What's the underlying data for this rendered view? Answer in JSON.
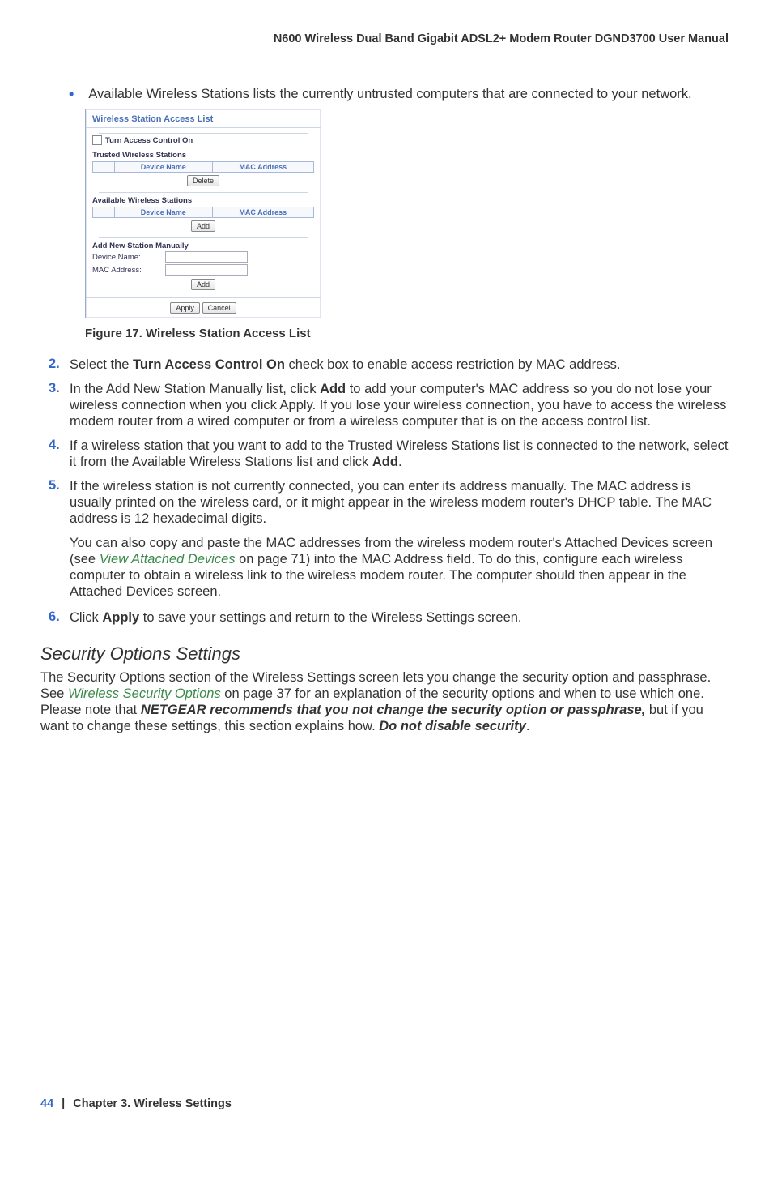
{
  "header": {
    "title": "N600 Wireless Dual Band Gigabit ADSL2+ Modem Router DGND3700 User Manual"
  },
  "bullet": {
    "text": "Available Wireless Stations lists the currently untrusted computers that are connected to your network."
  },
  "ui": {
    "title": "Wireless Station Access List",
    "checkbox_label": "Turn Access Control On",
    "trusted_section": "Trusted Wireless Stations",
    "available_section": "Available Wireless Stations",
    "col_device": "Device Name",
    "col_mac": "MAC Address",
    "btn_delete": "Delete",
    "btn_add": "Add",
    "manual_section": "Add New Station Manually",
    "label_device": "Device Name:",
    "label_mac": "MAC Address:",
    "btn_apply": "Apply",
    "btn_cancel": "Cancel"
  },
  "figure": {
    "caption": "Figure 17.  Wireless Station Access List"
  },
  "steps": {
    "s2_a": "Select the ",
    "s2_b": "Turn Access Control On",
    "s2_c": " check box to enable access restriction by MAC address.",
    "s3_a": "In the Add New Station Manually list, click ",
    "s3_b": "Add",
    "s3_c": " to add your computer's MAC address so you do not lose your wireless connection when you click Apply. If you lose your wireless connection, you have to access the wireless modem router from a wired computer or from a wireless computer that is on the access control list.",
    "s4_a": "If a wireless station that you want to add to the Trusted Wireless Stations list is connected to the network, select it from the Available Wireless Stations list and click ",
    "s4_b": "Add",
    "s4_c": ".",
    "s5": "If the wireless station is not currently connected, you can enter its address manually. The MAC address is usually printed on the wireless card, or it might appear in the wireless modem router's DHCP table. The MAC address is 12 hexadecimal digits.",
    "s5_extra_a": "You can also copy and paste the MAC addresses from the wireless modem router's Attached Devices screen (see ",
    "s5_extra_link": "View Attached Devices",
    "s5_extra_b": " on page 71) into the MAC Address field. To do this, configure each wireless computer to obtain a wireless link to the wireless modem router. The computer should then appear in the Attached Devices screen.",
    "s6_a": "Click ",
    "s6_b": "Apply",
    "s6_c": " to save your settings and return to the Wireless Settings screen."
  },
  "subsection": {
    "title": "Security Options Settings",
    "p_a": "The Security Options section of the Wireless Settings screen lets you change the security option and passphrase. See ",
    "p_link": "Wireless Security Options",
    "p_b": " on page 37 for an explanation of the security options and when to use which one. Please note that ",
    "p_bi1": "NETGEAR recommends that you not change the security option or passphrase,",
    "p_c": " but if you want to change these settings, this section explains how. ",
    "p_bi2": "Do not disable security",
    "p_d": "."
  },
  "footer": {
    "page": "44",
    "sep": "|",
    "chapter": "Chapter 3.  Wireless Settings"
  },
  "nums": {
    "n2": "2.",
    "n3": "3.",
    "n4": "4.",
    "n5": "5.",
    "n6": "6."
  }
}
